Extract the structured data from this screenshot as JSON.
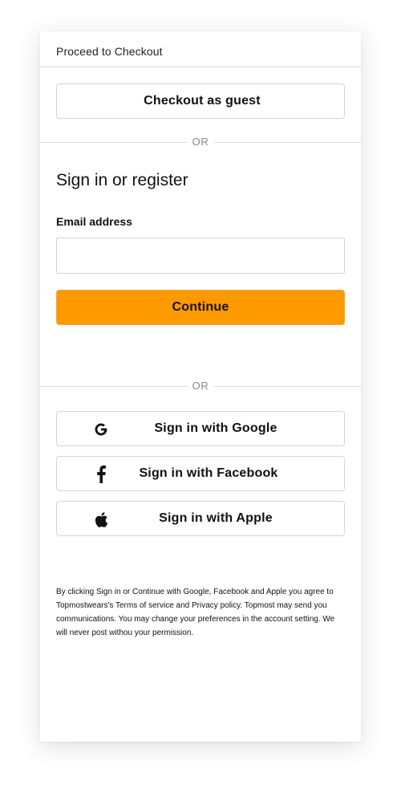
{
  "header": {
    "title": "Proceed to Checkout"
  },
  "guest": {
    "label": "Checkout as guest"
  },
  "dividers": {
    "or_text": "OR"
  },
  "signin": {
    "title": "Sign in or register",
    "email_label": "Email address",
    "email_value": "",
    "email_placeholder": "",
    "continue_label": "Continue"
  },
  "social": {
    "google": {
      "label": "Sign in with Google",
      "icon": "google-icon"
    },
    "facebook": {
      "label": "Sign in with Facebook",
      "icon": "facebook-icon"
    },
    "apple": {
      "label": "Sign in with Apple",
      "icon": "apple-icon"
    }
  },
  "legal": {
    "text": "By clicking Sign in or Continue with Google, Facebook and Apple you agree to Topmostwears's Terms of service and Privacy policy. Topmost may send you communications.  You may change your preferences in the account setting. We will never post withou your permission."
  },
  "colors": {
    "accent": "#ff9900",
    "border": "#d6d6d6",
    "divider": "#dcdcdc",
    "muted_text": "#888888"
  }
}
